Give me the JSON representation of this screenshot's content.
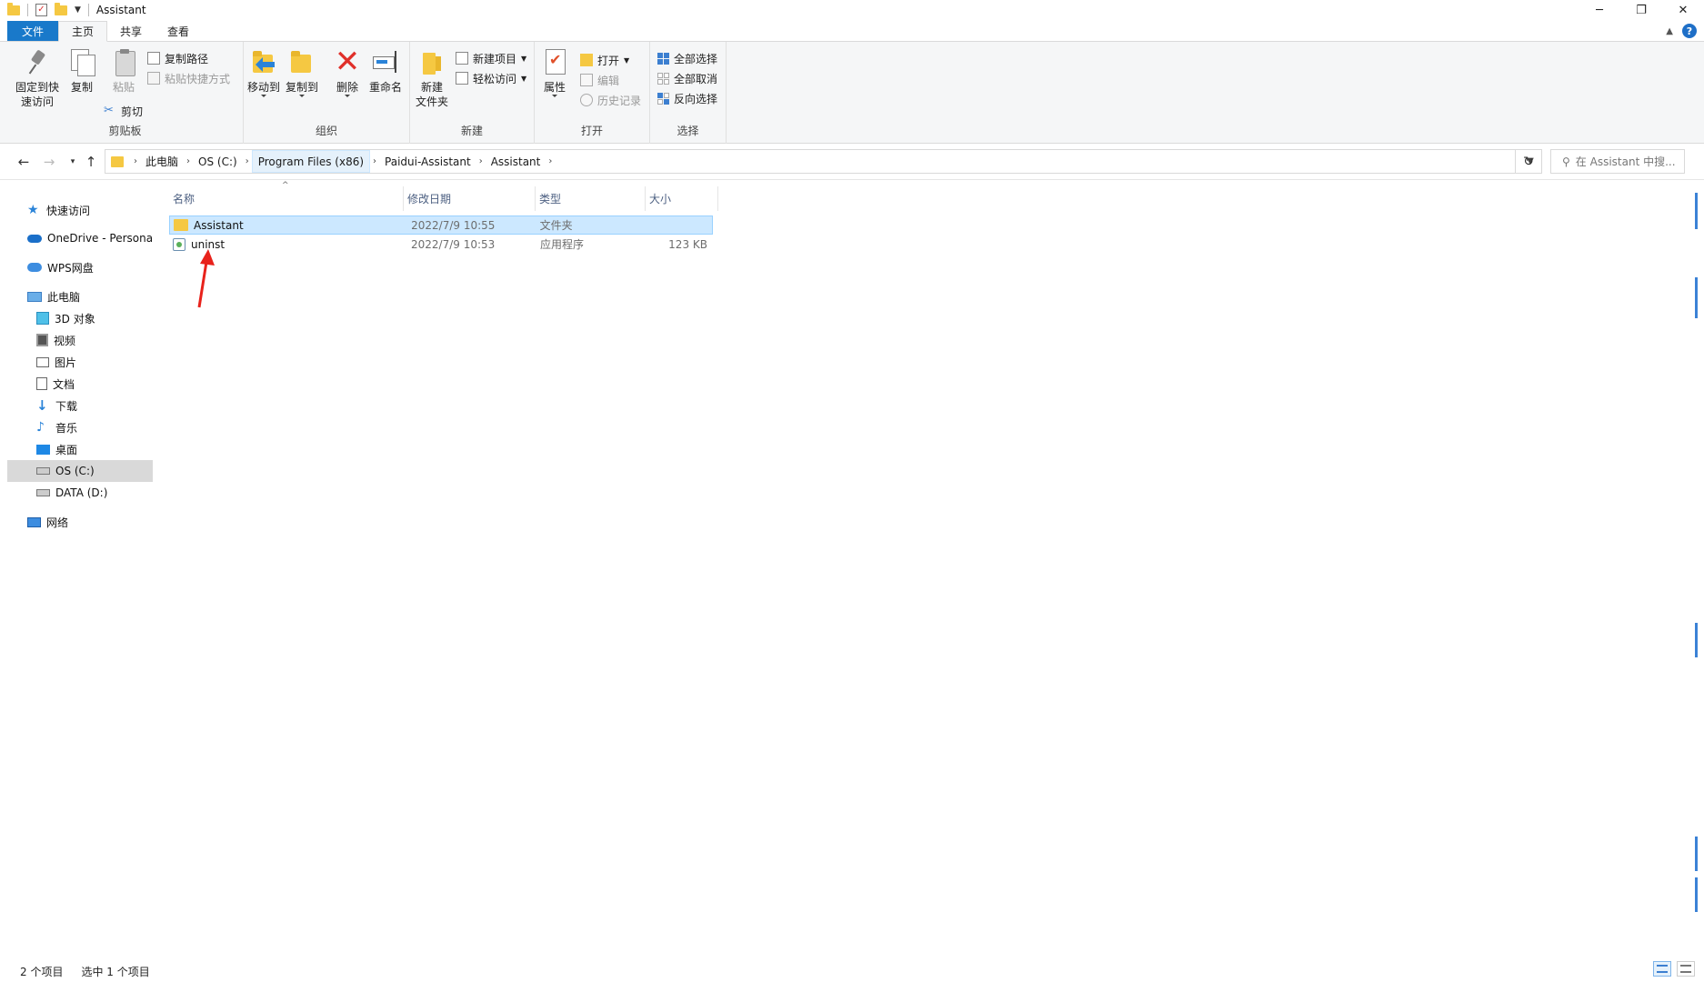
{
  "window": {
    "title": "Assistant",
    "minimize": "─",
    "restore": "❐",
    "close": "✕"
  },
  "ribbon_tabs": {
    "file": "文件",
    "home": "主页",
    "share": "共享",
    "view": "查看",
    "help": "?"
  },
  "clipboard": {
    "pin": "固定到快速访问",
    "pin_l1": "固定到快",
    "pin_l2": "速访问",
    "copy": "复制",
    "paste": "粘贴",
    "copy_path": "复制路径",
    "paste_shortcut": "粘贴快捷方式",
    "cut": "剪切",
    "label": "剪贴板"
  },
  "organize": {
    "move_to": "移动到",
    "copy_to": "复制到",
    "delete": "删除",
    "rename": "重命名",
    "label": "组织"
  },
  "new_group": {
    "new_folder_l1": "新建",
    "new_folder_l2": "文件夹",
    "new_item": "新建项目",
    "easy_access": "轻松访问",
    "label": "新建"
  },
  "open_group": {
    "properties": "属性",
    "open": "打开",
    "edit": "编辑",
    "history": "历史记录",
    "label": "打开"
  },
  "select_group": {
    "select_all": "全部选择",
    "select_none": "全部取消",
    "invert": "反向选择",
    "label": "选择"
  },
  "address": {
    "crumbs": [
      "此电脑",
      "OS (C:)",
      "Program Files (x86)",
      "Paidui-Assistant",
      "Assistant"
    ],
    "search_placeholder": "在 Assistant 中搜..."
  },
  "nav_pane": {
    "quick_access": "快速访问",
    "onedrive": "OneDrive - Persona",
    "wps": "WPS网盘",
    "this_pc": "此电脑",
    "objects3d": "3D 对象",
    "videos": "视频",
    "pictures": "图片",
    "documents": "文档",
    "downloads": "下载",
    "music": "音乐",
    "desktop": "桌面",
    "os_c": "OS (C:)",
    "data_d": "DATA (D:)",
    "network": "网络"
  },
  "columns": {
    "name": "名称",
    "date": "修改日期",
    "type": "类型",
    "size": "大小"
  },
  "files": [
    {
      "name": "Assistant",
      "date": "2022/7/9 10:55",
      "type": "文件夹",
      "size": ""
    },
    {
      "name": "uninst",
      "date": "2022/7/9 10:53",
      "type": "应用程序",
      "size": "123 KB"
    }
  ],
  "status": {
    "count": "2 个项目",
    "selected": "选中 1 个项目"
  },
  "colors": {
    "accent": "#1979ca",
    "selection": "#cce8ff",
    "annotation": "#e8221b"
  }
}
